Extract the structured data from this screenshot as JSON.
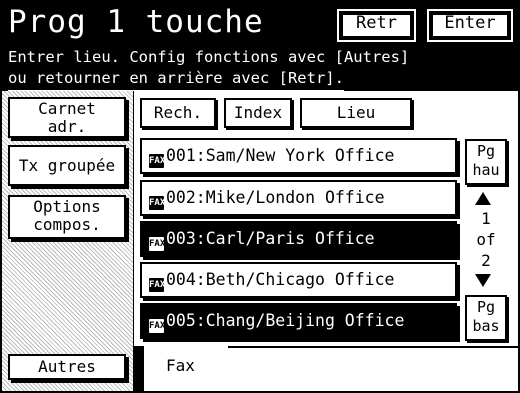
{
  "header": {
    "title": "Prog 1 touche",
    "instruction_line1": "Entrer lieu. Config fonctions avec [Autres]",
    "instruction_line2": "ou retourner en arrière avec [Retr].",
    "retr_label": "Retr",
    "enter_label": "Enter"
  },
  "sidebar": {
    "carnet_label": "Carnet\nadr.",
    "tx_group_label": "Tx groupée",
    "options_label": "Options\ncompos.",
    "autres_label": "Autres"
  },
  "search_tabs": {
    "rech_label": "Rech.",
    "index_label": "Index",
    "lieu_label": "Lieu"
  },
  "entries": [
    {
      "badge": "FAX",
      "label": "001:Sam/New York Office",
      "selected": false
    },
    {
      "badge": "FAX",
      "label": "002:Mike/London Office",
      "selected": false
    },
    {
      "badge": "FAX",
      "label": "003:Carl/Paris Office",
      "selected": true
    },
    {
      "badge": "FAX",
      "label": "004:Beth/Chicago Office",
      "selected": false
    },
    {
      "badge": "FAX",
      "label": "005:Chang/Beijing Office",
      "selected": true
    }
  ],
  "pager": {
    "up_label": "Pg\nhau",
    "down_label": "Pg\nbas",
    "indicator": "1\nof\n2"
  },
  "bottom_tabs": {
    "fax_label": "Fax"
  }
}
